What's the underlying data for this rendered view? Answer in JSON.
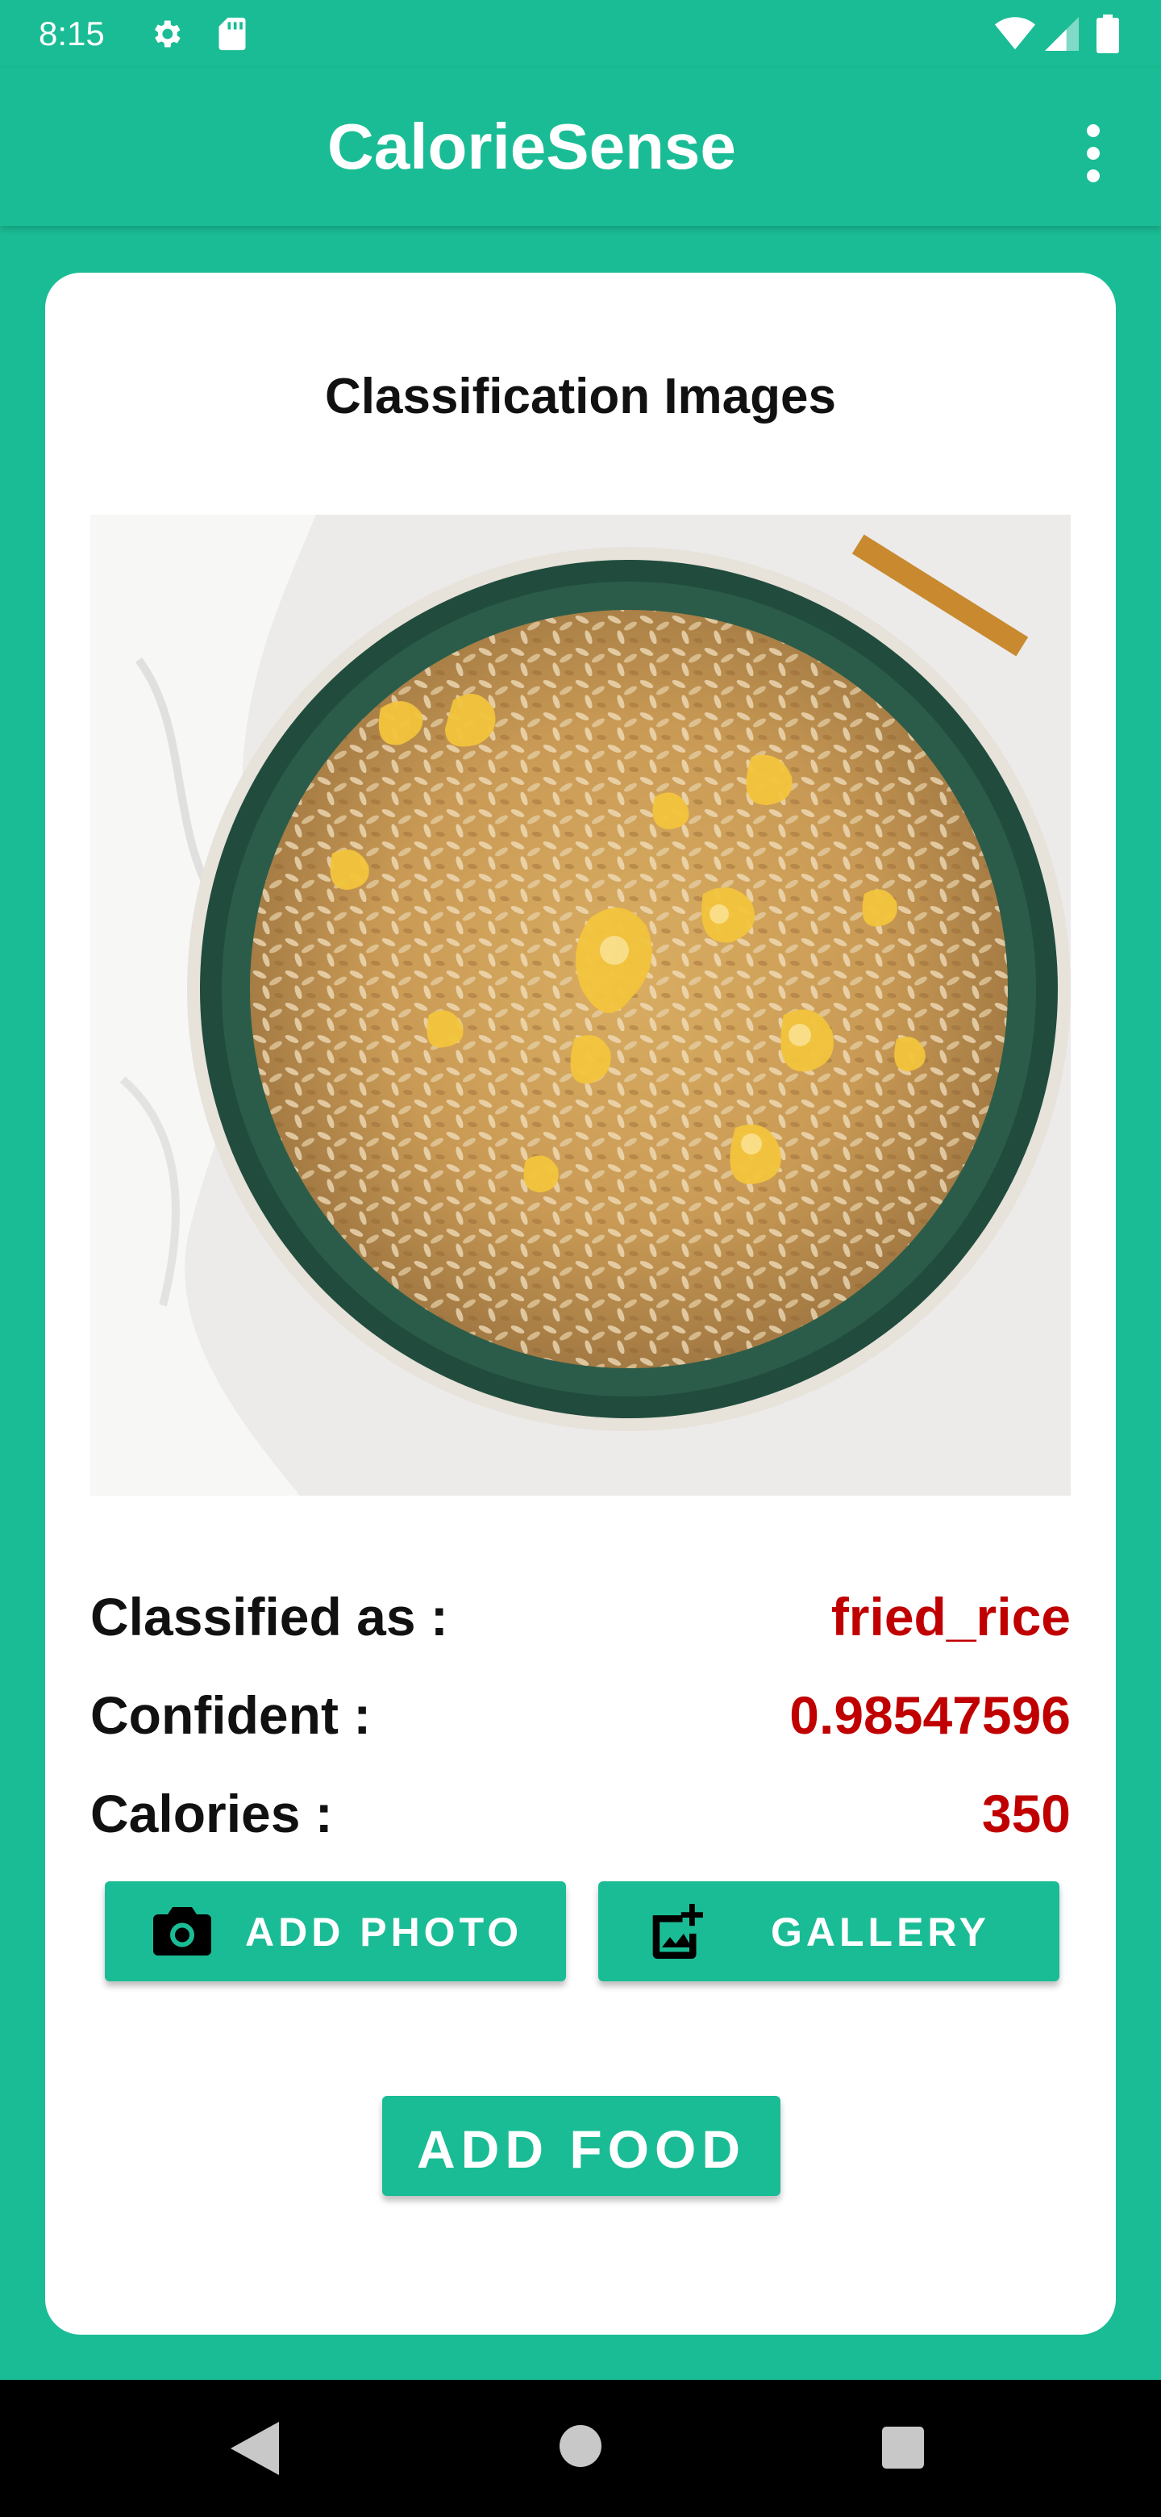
{
  "status_bar": {
    "time": "8:15",
    "icons": [
      "gear-icon",
      "sd-card-icon",
      "wifi-icon",
      "cell-signal-icon",
      "battery-icon"
    ]
  },
  "app_bar": {
    "title": "CalorieSense",
    "menu_icon": "more-vert-icon"
  },
  "card": {
    "title": "Classification Images",
    "image_subject": "fried rice in a bowl",
    "results": {
      "classified_label": "Classified as :",
      "classified_value": "fried_rice",
      "confident_label": "Confident :",
      "confident_value": "0.98547596",
      "calories_label": "Calories :",
      "calories_value": "350"
    },
    "buttons": {
      "add_photo": "ADD PHOTO",
      "gallery": "GALLERY",
      "add_food": "ADD FOOD"
    }
  },
  "nav_bar": {
    "icons": [
      "back-icon",
      "home-icon",
      "recents-icon"
    ]
  },
  "colors": {
    "primary": "#1abc95",
    "value_red": "#c00000",
    "card_bg": "#ffffff",
    "nav_bg": "#000000"
  }
}
